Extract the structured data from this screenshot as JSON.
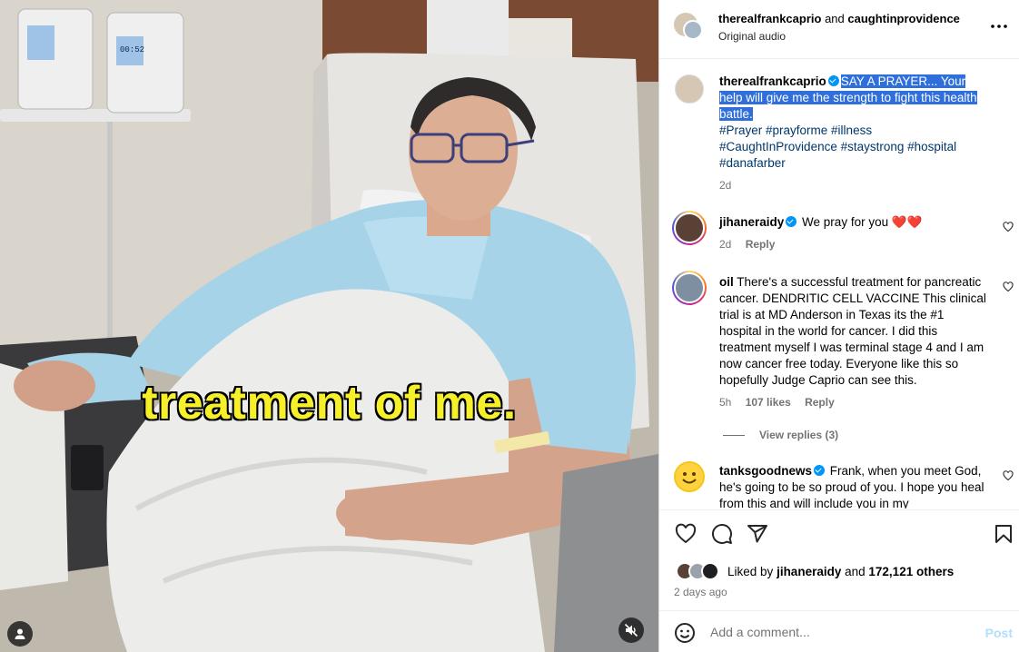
{
  "media": {
    "caption": "treatment of me.",
    "pump_display": "00:52",
    "user_tag_icon": "person-icon",
    "mute_icon": "speaker-muted-icon"
  },
  "header": {
    "author": "therealfrankcaprio",
    "connector": "and",
    "collaborator": "caughtinprovidence",
    "audio": "Original audio",
    "more_icon": "more-options-icon"
  },
  "post_caption": {
    "author": "therealfrankcaprio",
    "text": "SAY A PRAYER... Your help will give me the strength to fight this health battle.",
    "tags_line1": "#Prayer #prayforme #illness",
    "tags_line2": "#CaughtInProvidence #staystrong #hospital",
    "tags_line3": "#danafarber",
    "time": "2d"
  },
  "comments": [
    {
      "username": "jihaneraidy",
      "text": "We pray for you",
      "emoji": "❤️❤️",
      "time": "2d",
      "reply": "Reply"
    },
    {
      "username": "oil",
      "text": "There's a successful treatment for pancreatic cancer. DENDRITIC CELL VACCINE This clinical trial is at MD Anderson in Texas its the #1 hospital in the world for cancer. I did this treatment myself I was terminal stage 4 and I am now cancer free today. Everyone like this so hopefully Judge Caprio can see this.",
      "time": "5h",
      "likes": "107 likes",
      "reply": "Reply",
      "view_replies": "View replies (3)"
    },
    {
      "username": "tanksgoodnews",
      "text": "Frank, when you meet God, he's going to be so proud of you. I hope you heal from this and will include you in my",
      "time": "",
      "reply": ""
    }
  ],
  "actions": {
    "like_icon": "heart-icon",
    "comment_icon": "comment-icon",
    "share_icon": "paper-plane-icon",
    "save_icon": "bookmark-icon"
  },
  "likes": {
    "prefix": "Liked by",
    "user": "jihaneraidy",
    "connector": "and",
    "others": "172,121 others"
  },
  "date": "2 days ago",
  "add_comment": {
    "placeholder": "Add a comment...",
    "post_label": "Post"
  },
  "colors": {
    "link": "#00376b",
    "selection": "#2f6fdb",
    "verified": "#0095f6",
    "post_disabled": "#b2dffc",
    "caption_yellow": "#f6f02a"
  }
}
